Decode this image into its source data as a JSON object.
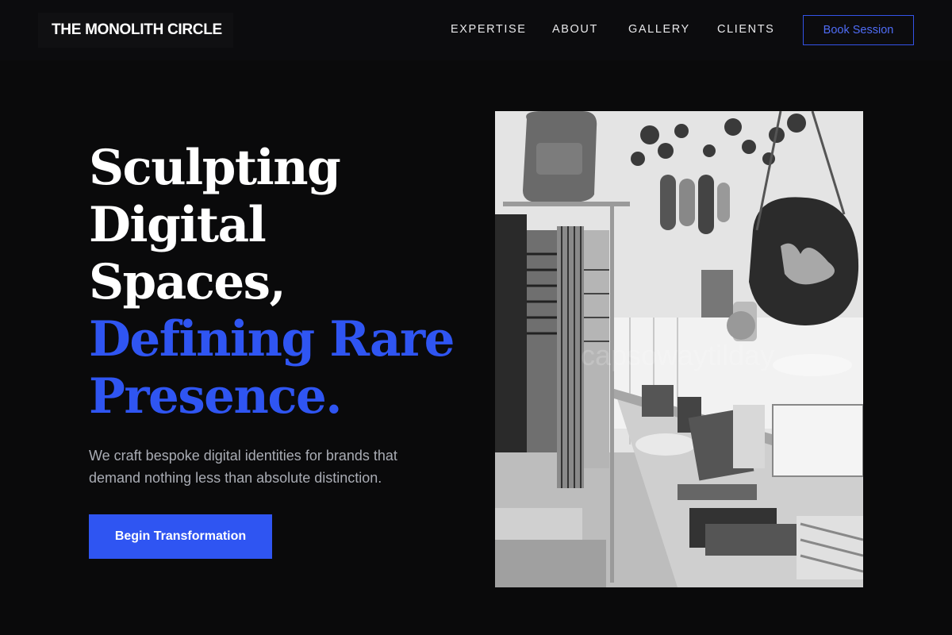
{
  "brand": {
    "name": "THE MONOLITH CIRCLE"
  },
  "nav": {
    "items": [
      {
        "label": "EXPERTISE"
      },
      {
        "label": "ABOUT"
      },
      {
        "label": "GALLERY"
      },
      {
        "label": "CLIENTS"
      }
    ],
    "cta_label": "Book Session"
  },
  "hero": {
    "headline_white": [
      "Sculpting",
      "Digital",
      "Spaces,"
    ],
    "headline_accent": [
      "Defining Rare",
      "Presence."
    ],
    "subtitle": "We craft bespoke digital identities for brands that demand nothing less than absolute distinction.",
    "cta_label": "Begin Transformation"
  },
  "image": {
    "description": "grayscale-boutique-interior-photo",
    "watermark": "capsowaytilday"
  },
  "colors": {
    "background": "#0a0a0b",
    "accent": "#2f55f2",
    "text": "#ffffff",
    "muted_text": "#a9acb4"
  }
}
